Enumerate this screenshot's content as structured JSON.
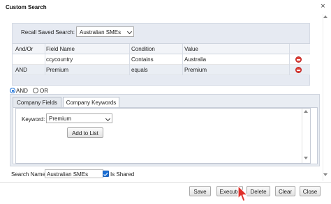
{
  "dialog": {
    "title": "Custom Search",
    "close_glyph": "×"
  },
  "recall": {
    "label": "Recall Saved Search:",
    "selected": "Australian SMEs"
  },
  "grid": {
    "columns": [
      "And/Or",
      "Field Name",
      "Condition",
      "Value"
    ],
    "rows": [
      {
        "andor": "",
        "field": "ccycountry",
        "condition": "Contains",
        "value": "Australia"
      },
      {
        "andor": "AND",
        "field": "Premium",
        "condition": "equals",
        "value": "Premium"
      }
    ],
    "delete_icon": "delete-row-icon",
    "delete_color": "#e0443a"
  },
  "logic": {
    "and_label": "AND",
    "or_label": "OR",
    "selected": "AND"
  },
  "tabs": [
    {
      "label": "Company Fields",
      "active": false
    },
    {
      "label": "Company Keywords",
      "active": true
    }
  ],
  "keywords": {
    "label": "Keyword:",
    "selected": "Premium",
    "add_label": "Add to List"
  },
  "search_name": {
    "label": "Search Name:",
    "value": "Australian SMEs",
    "shared_label": "Is Shared",
    "shared_checked": true
  },
  "footer": {
    "save": "Save",
    "execute": "Execute",
    "delete": "Delete",
    "clear": "Clear",
    "close": "Close"
  },
  "colors": {
    "accent": "#1a6fd6",
    "panel": "#e6eaf2",
    "cursor": "#e0302a"
  }
}
